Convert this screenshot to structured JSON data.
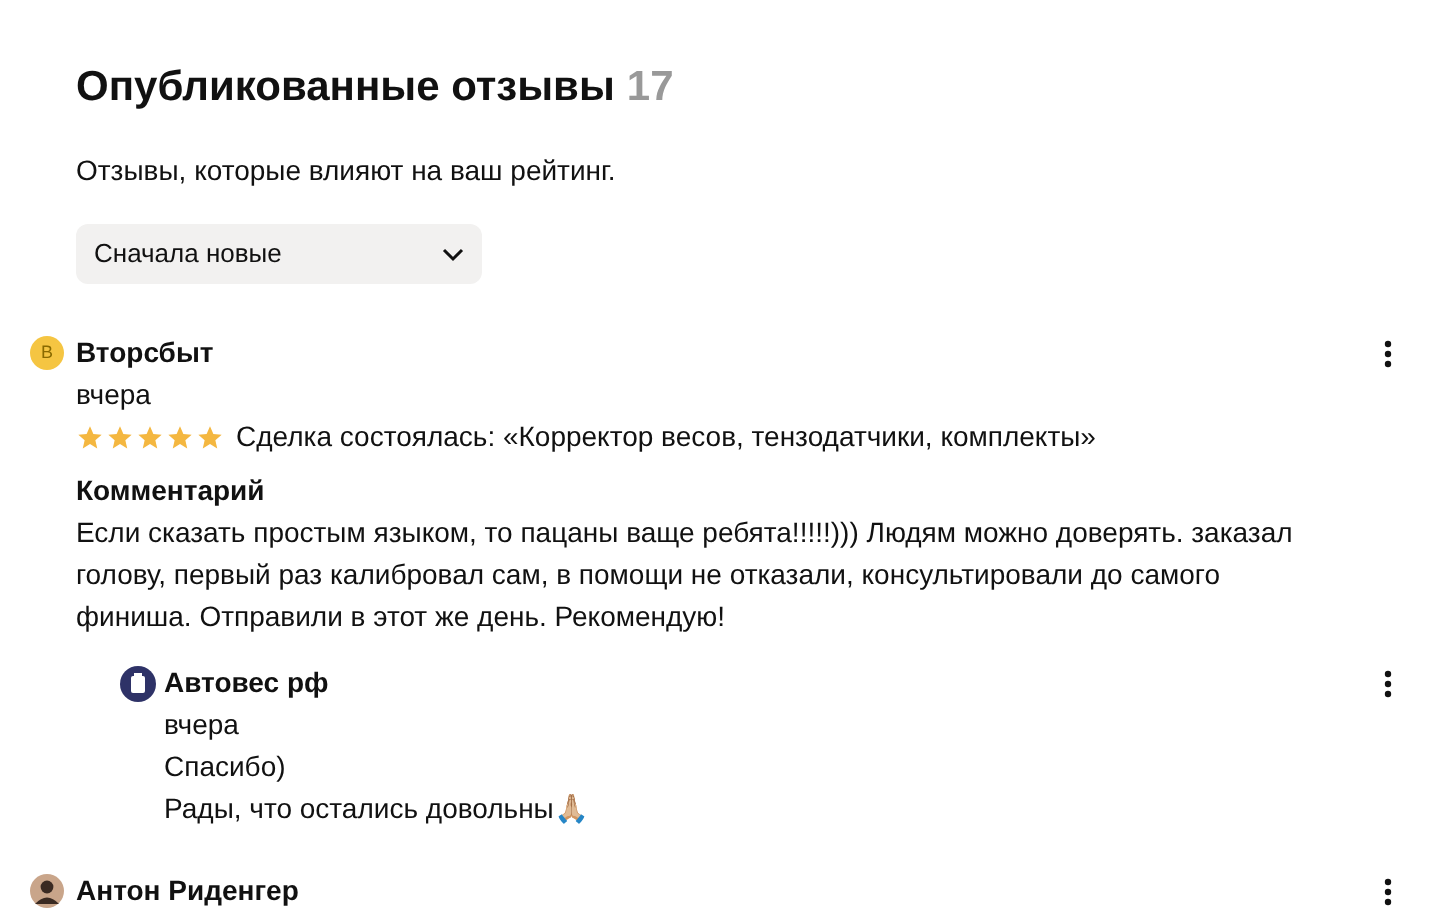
{
  "header": {
    "title": "Опубликованные отзывы",
    "count": "17",
    "subtitle": "Отзывы, которые влияют на ваш рейтинг."
  },
  "sort": {
    "value": "Сначала новые"
  },
  "reviews": [
    {
      "avatar": {
        "kind": "letter",
        "letter": "В"
      },
      "author": "Вторсбыт",
      "date": "вчера",
      "stars": 5,
      "deal": "Сделка состоялась: «Корректор весов, тензодатчики, комплекты»",
      "comment_label": "Комментарий",
      "comment": "Если сказать простым языком, то пацаны ваще ребята!!!!!))) Людям можно доверять. заказал голову, первый раз калибровал сам, в помощи не отказали, консультировали до самого финиша. Отправили в этот же день. Рекомендую!",
      "reply": {
        "avatar": {
          "kind": "logo"
        },
        "author": "Автовес рф",
        "date": "вчера",
        "lines": [
          "Спасибо)",
          "Рады, что остались довольны🙏🏼"
        ]
      }
    },
    {
      "avatar": {
        "kind": "photo"
      },
      "author": "Антон Риденгер"
    }
  ]
}
